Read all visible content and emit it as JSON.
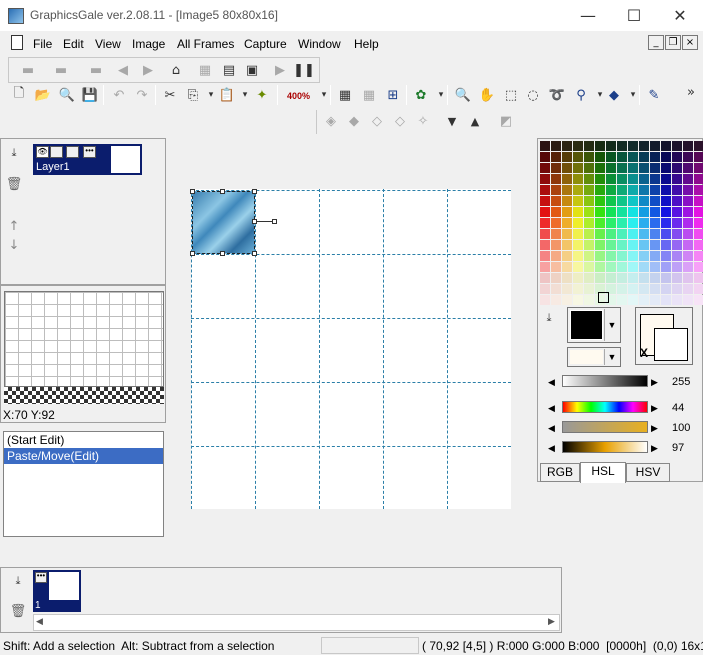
{
  "window": {
    "title": "GraphicsGale ver.2.08.11 - [Image5 80x80x16]",
    "min_glyph": "—",
    "max_glyph": "☐",
    "close_glyph": "✕"
  },
  "menu": [
    "File",
    "Edit",
    "View",
    "Image",
    "All Frames",
    "Capture",
    "Window",
    "Help"
  ],
  "mdi": {
    "min": "_",
    "restore": "❐",
    "close": "×"
  },
  "toolbar": {
    "zoom": "400%",
    "more": "»"
  },
  "layers": {
    "items": [
      {
        "name": "Layer1"
      }
    ]
  },
  "coords": {
    "cursor": "X:70 Y:92"
  },
  "history": {
    "items": [
      "(Start Edit)",
      "Paste/Move(Edit)"
    ],
    "selected_index": 1
  },
  "frames": {
    "items": [
      {
        "number": "1"
      }
    ]
  },
  "color": {
    "foreground": "#000000",
    "background": "#fffaf0",
    "x_label": "X",
    "gray_value": "255",
    "hue_value": "44",
    "sat_value": "100",
    "lum_value": "97",
    "tabs": [
      "RGB",
      "HSL",
      "HSV"
    ],
    "active_tab": "HSL"
  },
  "status": {
    "hint": "Shift: Add a selection  Alt: Subtract from a selection",
    "info": "( 70,92 [4,5] ) R:000 G:000 B:000  [0000h]  (0,0) 16x1"
  }
}
